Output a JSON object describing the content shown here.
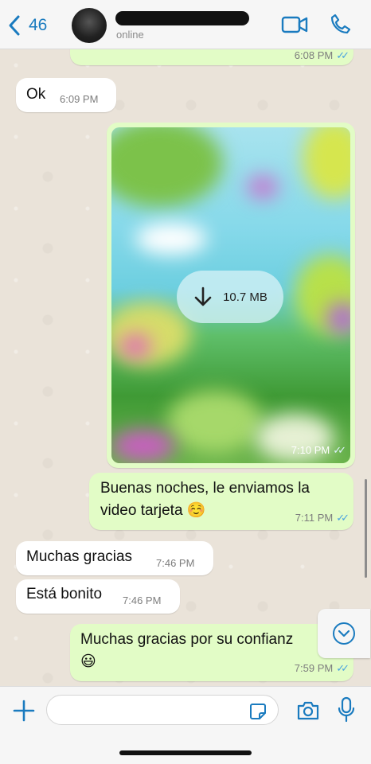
{
  "header": {
    "back_count": "46",
    "contact_status": "online"
  },
  "messages": [
    {
      "text": "",
      "time": "6:08 PM",
      "ticks": "✓✓"
    },
    {
      "text": "Ok",
      "time": "6:09 PM"
    },
    {
      "video": {
        "size": "10.7 MB",
        "time": "7:10 PM",
        "ticks": "✓✓"
      }
    },
    {
      "text": "Buenas noches, le enviamos la video tarjeta ☺️",
      "line1": "Buenas noches, le enviamos la",
      "line2": "video tarjeta ☺️",
      "time": "7:11 PM",
      "ticks": "✓✓"
    },
    {
      "text": "Muchas gracias",
      "time": "7:46 PM"
    },
    {
      "text": "Está bonito",
      "time": "7:46 PM"
    },
    {
      "line1": "Muchas gracias por su confianz",
      "line2": "😃",
      "time": "7:59 PM",
      "ticks": "✓✓"
    }
  ],
  "composer": {
    "placeholder": ""
  },
  "colors": {
    "accent": "#1a7bbf",
    "outgoing": "#e2fcc6",
    "incoming": "#ffffff",
    "read_ticks": "#4aa3df"
  }
}
